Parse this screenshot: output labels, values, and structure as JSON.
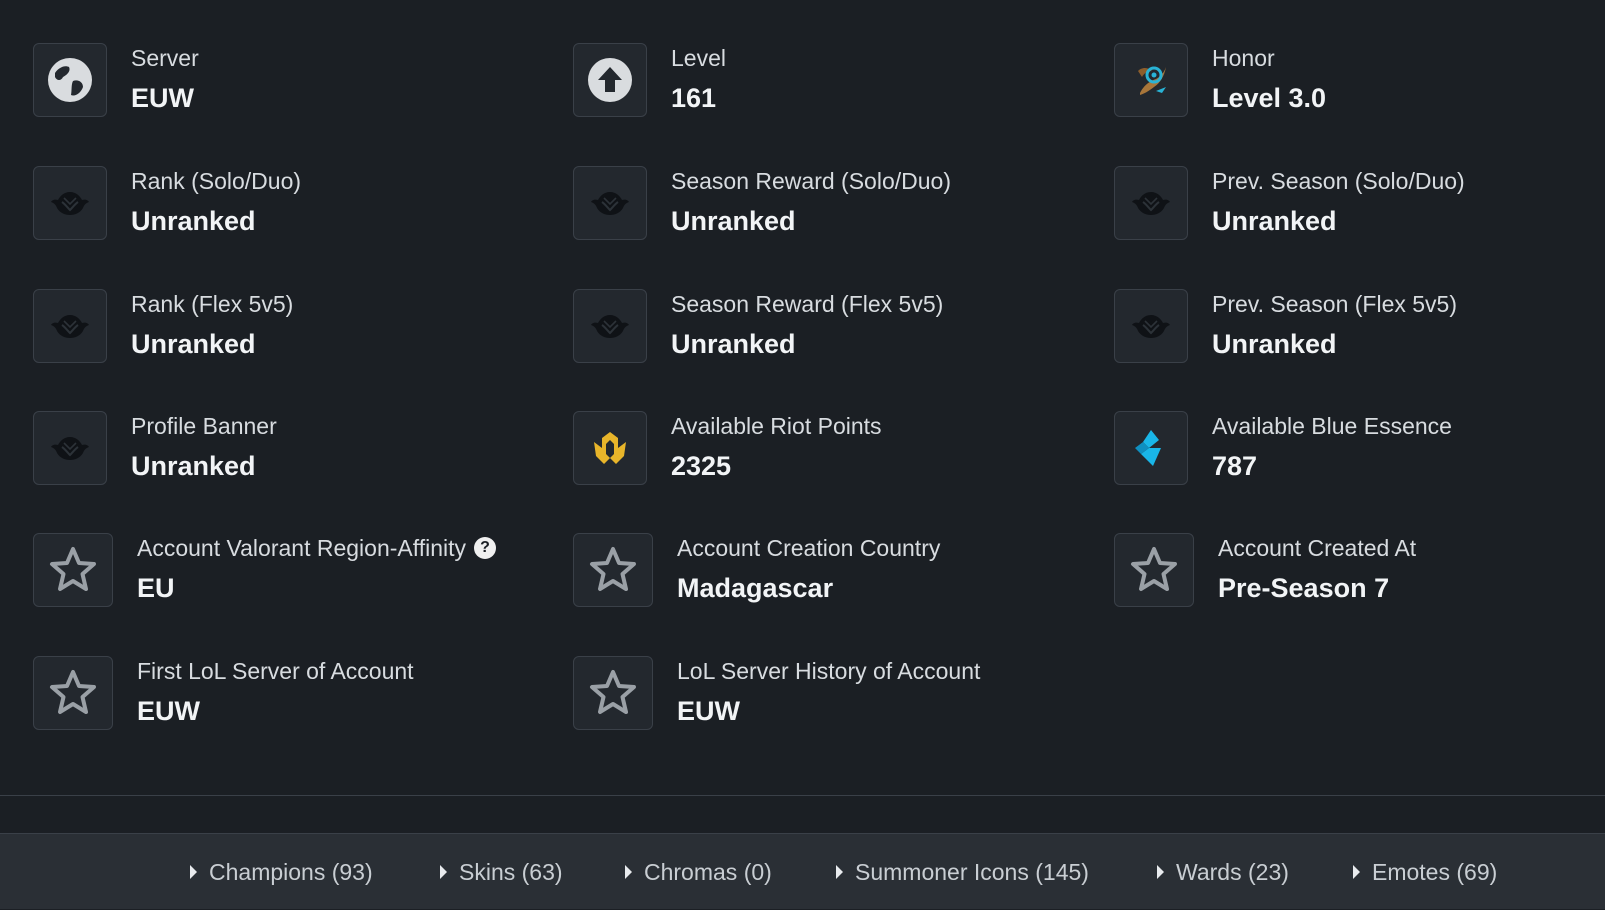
{
  "stats": [
    {
      "label": "Server",
      "value": "EUW",
      "icon": "globe-icon"
    },
    {
      "label": "Level",
      "value": "161",
      "icon": "level-up-arrow-icon"
    },
    {
      "label": "Honor",
      "value": "Level 3.0",
      "icon": "honor-emblem-icon"
    },
    {
      "label": "Rank (Solo/Duo)",
      "value": "Unranked",
      "icon": "unranked-crest-icon"
    },
    {
      "label": "Season Reward (Solo/Duo)",
      "value": "Unranked",
      "icon": "unranked-crest-icon"
    },
    {
      "label": "Prev. Season (Solo/Duo)",
      "value": "Unranked",
      "icon": "unranked-crest-icon"
    },
    {
      "label": "Rank (Flex 5v5)",
      "value": "Unranked",
      "icon": "unranked-crest-icon"
    },
    {
      "label": "Season Reward (Flex 5v5)",
      "value": "Unranked",
      "icon": "unranked-crest-icon"
    },
    {
      "label": "Prev. Season (Flex 5v5)",
      "value": "Unranked",
      "icon": "unranked-crest-icon"
    },
    {
      "label": "Profile Banner",
      "value": "Unranked",
      "icon": "unranked-crest-icon"
    },
    {
      "label": "Available Riot Points",
      "value": "2325",
      "icon": "riot-points-icon"
    },
    {
      "label": "Available Blue Essence",
      "value": "787",
      "icon": "blue-essence-icon"
    },
    {
      "label": "Account Valorant Region-Affinity",
      "value": "EU",
      "icon": "star-icon",
      "help": "?"
    },
    {
      "label": "Account Creation Country",
      "value": "Madagascar",
      "icon": "star-icon"
    },
    {
      "label": "Account Created At",
      "value": "Pre-Season 7",
      "icon": "star-icon"
    },
    {
      "label": "First LoL Server of Account",
      "value": "EUW",
      "icon": "star-icon"
    },
    {
      "label": "LoL Server History of Account",
      "value": "EUW",
      "icon": "star-icon"
    }
  ],
  "tabs": [
    {
      "label": "Champions (93)"
    },
    {
      "label": "Skins (63)"
    },
    {
      "label": "Chromas (0)"
    },
    {
      "label": "Summoner Icons (145)"
    },
    {
      "label": "Wards (23)"
    },
    {
      "label": "Emotes (69)"
    }
  ],
  "colors": {
    "background": "#1b1f24",
    "riot_points": "#e8b52a",
    "blue_essence": "#19b6e8",
    "honor_accent": "#29b3d6"
  }
}
